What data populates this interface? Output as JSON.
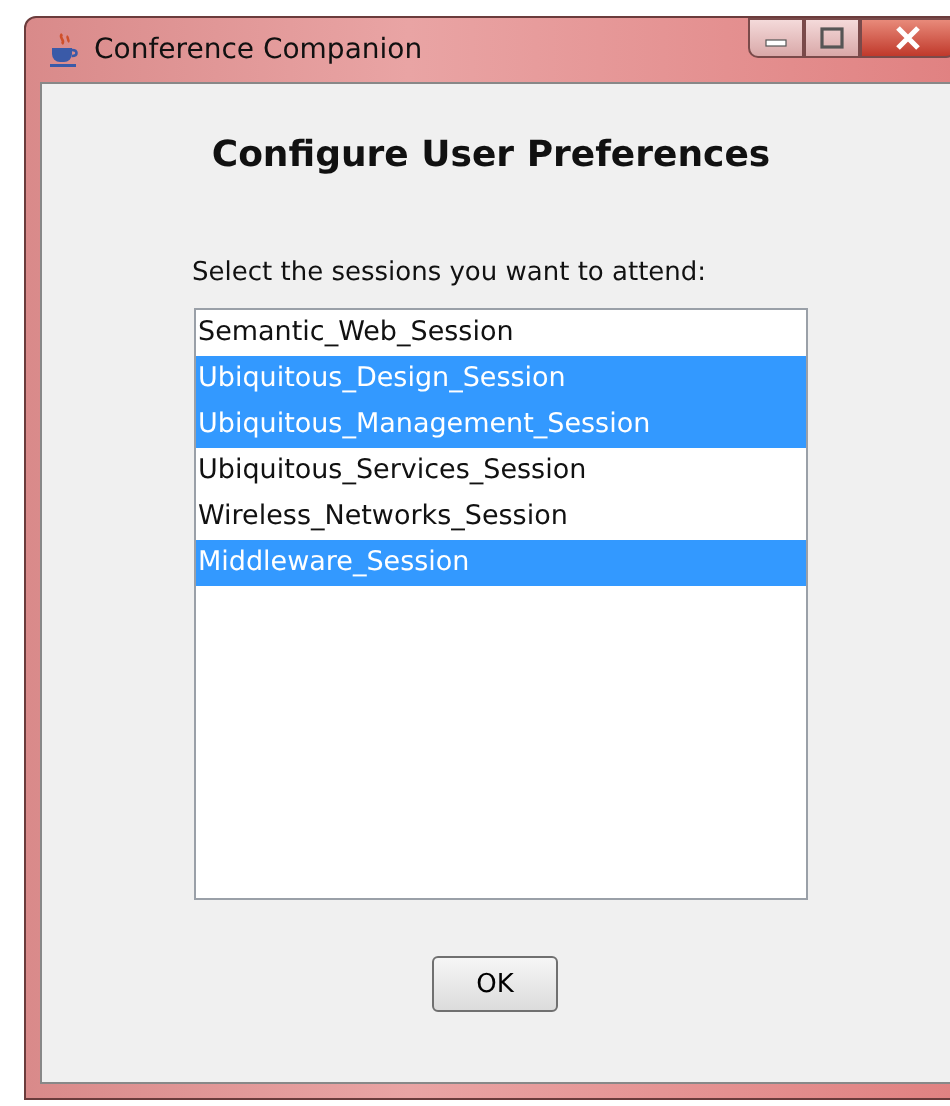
{
  "window": {
    "title": "Conference Companion"
  },
  "heading": "Configure User Preferences",
  "prompt": "Select the sessions you want to attend:",
  "sessions": [
    {
      "label": "Semantic_Web_Session",
      "selected": false
    },
    {
      "label": "Ubiquitous_Design_Session",
      "selected": true
    },
    {
      "label": "Ubiquitous_Management_Session",
      "selected": true
    },
    {
      "label": "Ubiquitous_Services_Session",
      "selected": false
    },
    {
      "label": "Wireless_Networks_Session",
      "selected": false
    },
    {
      "label": "Middleware_Session",
      "selected": true
    }
  ],
  "buttons": [
    "OK"
  ]
}
